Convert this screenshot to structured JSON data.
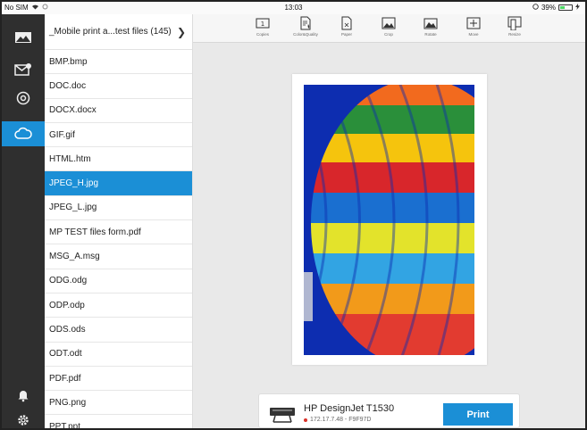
{
  "status_bar": {
    "carrier": "No SIM",
    "time": "13:03",
    "battery": "39%"
  },
  "file_list": {
    "folder_title": "_Mobile print a...test files (145)",
    "files": [
      {
        "name": "BMP.bmp"
      },
      {
        "name": "DOC.doc"
      },
      {
        "name": "DOCX.docx"
      },
      {
        "name": "GIF.gif"
      },
      {
        "name": "HTML.htm"
      },
      {
        "name": "JPEG_H.jpg",
        "selected": true
      },
      {
        "name": "JPEG_L.jpg"
      },
      {
        "name": "MP TEST files form.pdf"
      },
      {
        "name": "MSG_A.msg"
      },
      {
        "name": "ODG.odg"
      },
      {
        "name": "ODP.odp"
      },
      {
        "name": "ODS.ods"
      },
      {
        "name": "ODT.odt"
      },
      {
        "name": "PDF.pdf"
      },
      {
        "name": "PNG.png"
      },
      {
        "name": "PPT.ppt"
      }
    ]
  },
  "toolbar": {
    "copies_count": "1",
    "items": [
      "Copies",
      "Color&Quality",
      "Paper",
      "Crop",
      "Rotate",
      "Move",
      "Resize"
    ]
  },
  "printer": {
    "name": "HP DesignJet T1530",
    "address": "172.17.7.48 - F9F97D",
    "print_label": "Print",
    "status_color": "#d9322a"
  },
  "colors": {
    "accent": "#1b8fd6",
    "rail": "#2f2f2f"
  }
}
